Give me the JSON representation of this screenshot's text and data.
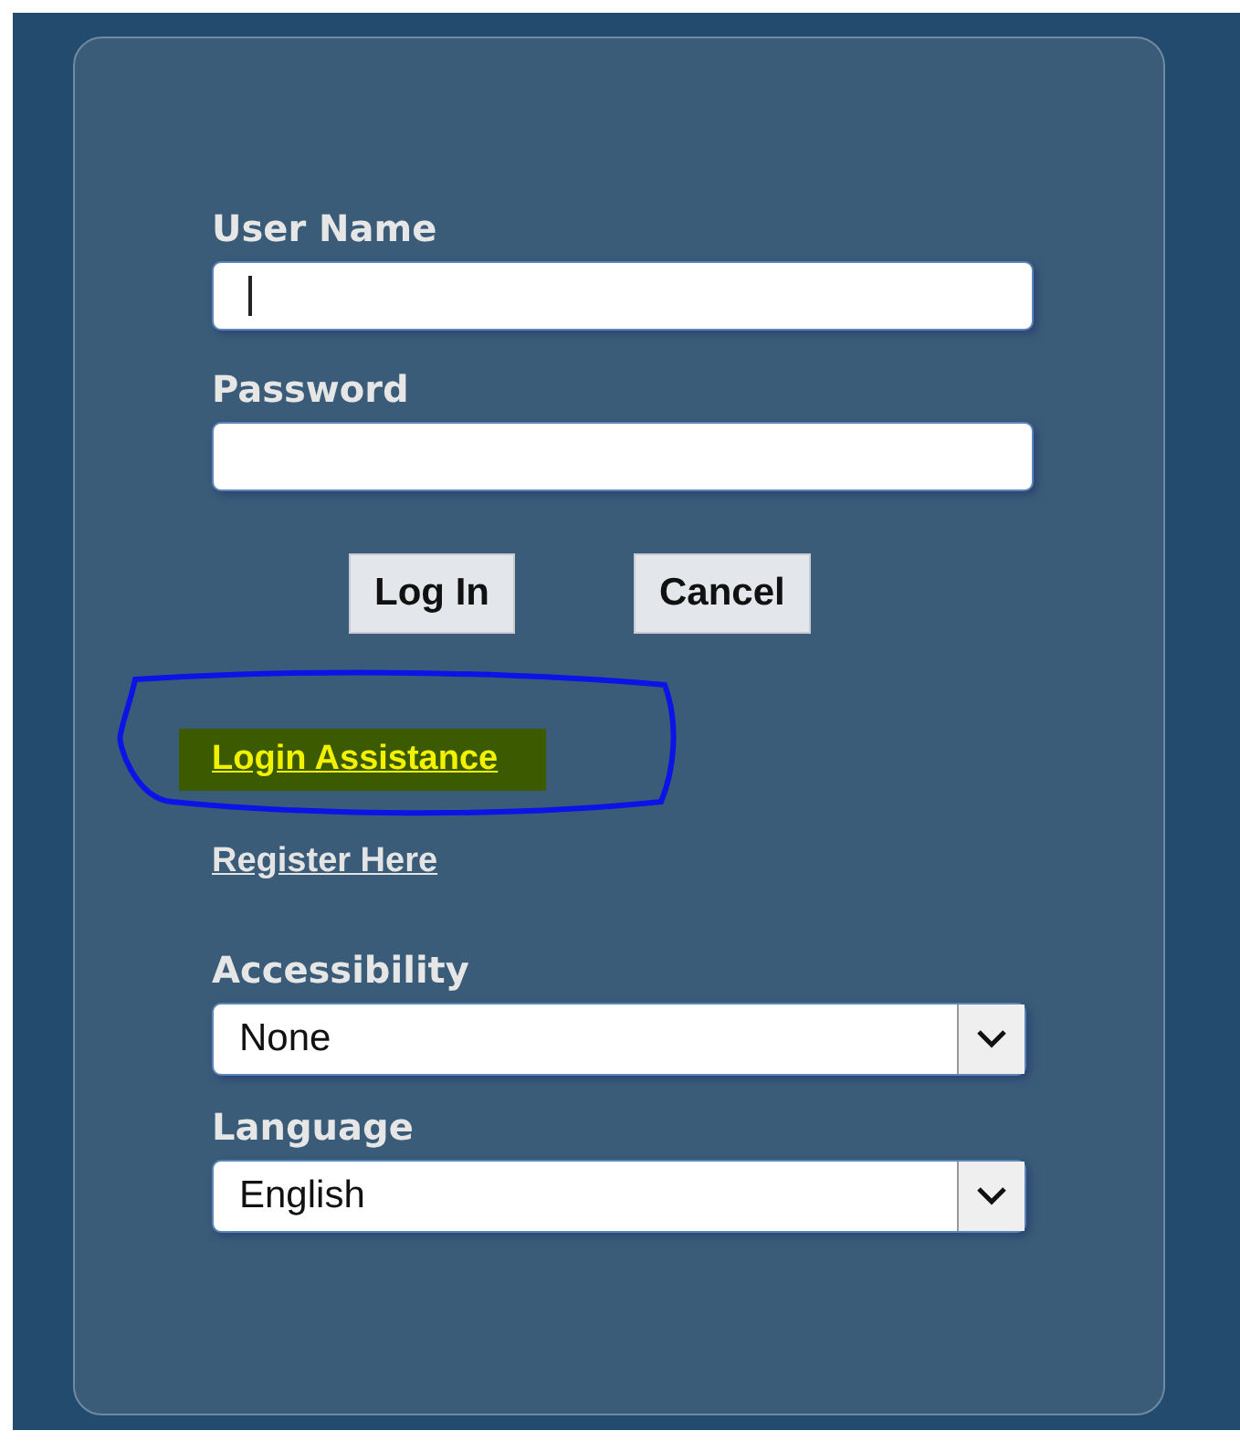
{
  "login_form": {
    "username": {
      "label": "User Name",
      "focused": true
    },
    "password": {
      "label": "Password"
    },
    "buttons": [
      {
        "label": "Log In"
      },
      {
        "label": "Cancel"
      }
    ],
    "links": [
      {
        "label": "Login Assistance",
        "highlighted": true
      },
      {
        "label": "Register Here",
        "highlighted": false
      }
    ],
    "accessibility": {
      "label": "Accessibility",
      "value": "None"
    },
    "language": {
      "label": "Language",
      "value": "English"
    }
  }
}
